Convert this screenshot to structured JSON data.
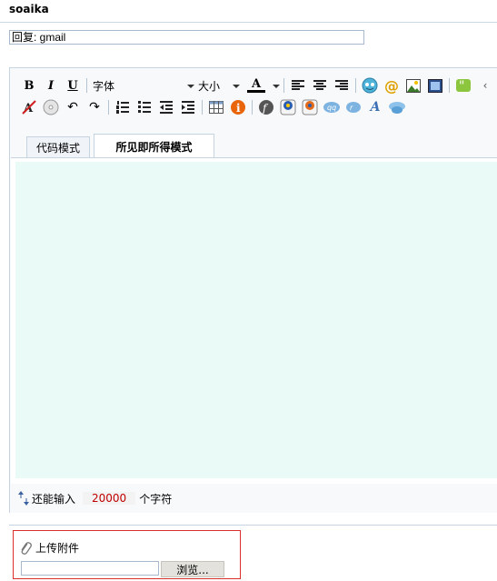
{
  "header": {
    "username": "soaika"
  },
  "subject": {
    "value": "回复: gmail"
  },
  "toolbar": {
    "bold_label": "B",
    "italic_label": "I",
    "underline_label": "U",
    "font_label": "字体",
    "size_label": "大小",
    "color_label": "A",
    "icons_row1": [
      "bold-icon",
      "italic-icon",
      "underline-icon",
      "font-dropdown",
      "size-dropdown",
      "font-color-icon",
      "align-left-icon",
      "align-center-icon",
      "align-right-icon",
      "emoticon-icon",
      "email-link-icon",
      "insert-image-icon",
      "insert-media-icon",
      "quote-icon",
      "code-icon"
    ],
    "icons_row2": [
      "remove-format-icon",
      "disc-icon",
      "undo-icon",
      "redo-icon",
      "ordered-list-icon",
      "unordered-list-icon",
      "outdent-icon",
      "indent-icon",
      "table-icon",
      "info-icon",
      "flash-icon",
      "real-media-icon",
      "windows-media-icon",
      "qq-icon",
      "chat-icon",
      "text-style-icon",
      "web-icon"
    ]
  },
  "tabs": {
    "code_mode": "代码模式",
    "wysiwyg_mode": "所见即所得模式"
  },
  "status": {
    "remaining_label": "还能输入",
    "remaining_count": "20000",
    "unit_label": "个字符"
  },
  "attachment": {
    "title": "上传附件",
    "file_value": "",
    "browse_label": "浏览..."
  },
  "colors": {
    "edit_bg": "#eafaf6",
    "border": "#c6d3e0",
    "highlight_border": "#d9302c",
    "count_color": "#c00000"
  }
}
